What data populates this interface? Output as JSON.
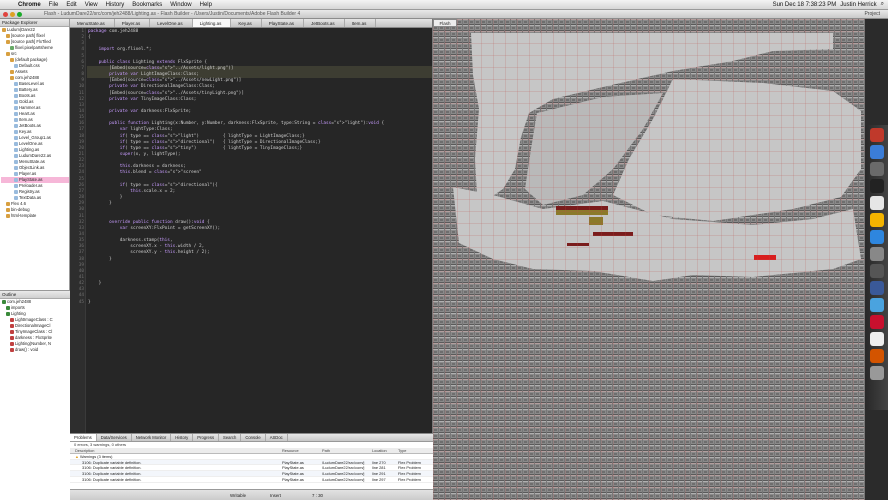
{
  "menubar": {
    "items": [
      "Chrome",
      "File",
      "Edit",
      "View",
      "History",
      "Bookmarks",
      "Window",
      "Help"
    ],
    "clock": "Sun Dec 18  7:38:23 PM",
    "user": "Justin Herrick"
  },
  "window": {
    "title": "Flash - LudumDare22/src/com/jeh2488/Lighting.as - Flash Builder - /Users/Justin/Documents/Adobe Flash Builder 4",
    "right_title": "Project"
  },
  "package_explorer": {
    "title": "Package Explorer",
    "items": [
      {
        "label": "Ludum(Dare22",
        "depth": 0,
        "color": "#d8a040"
      },
      {
        "label": "[source path] flixel",
        "depth": 1,
        "color": "#d8a040"
      },
      {
        "label": "[source path] FlxTiled",
        "depth": 1,
        "color": "#d8a040"
      },
      {
        "label": "flixel.pixelpartsheme",
        "depth": 2,
        "color": "#6a6"
      },
      {
        "label": "src",
        "depth": 1,
        "color": "#d8a040"
      },
      {
        "label": "(default package)",
        "depth": 2,
        "color": "#d8a040"
      },
      {
        "label": "Default.css",
        "depth": 3,
        "color": "#9bd"
      },
      {
        "label": "Assets",
        "depth": 2,
        "color": "#d8a040"
      },
      {
        "label": "com.jeh2488",
        "depth": 2,
        "color": "#d8a040"
      },
      {
        "label": "BaseLevel.as",
        "depth": 3,
        "color": "#9bd"
      },
      {
        "label": "Battery.as",
        "depth": 3,
        "color": "#9bd"
      },
      {
        "label": "Boots.as",
        "depth": 3,
        "color": "#9bd"
      },
      {
        "label": "Gold.as",
        "depth": 3,
        "color": "#9bd"
      },
      {
        "label": "Hammer.as",
        "depth": 3,
        "color": "#9bd"
      },
      {
        "label": "Heart.as",
        "depth": 3,
        "color": "#9bd"
      },
      {
        "label": "Item.as",
        "depth": 3,
        "color": "#9bd"
      },
      {
        "label": "JetBoots.as",
        "depth": 3,
        "color": "#9bd"
      },
      {
        "label": "Key.as",
        "depth": 3,
        "color": "#9bd"
      },
      {
        "label": "Level_Group1.as",
        "depth": 3,
        "color": "#9bd"
      },
      {
        "label": "LevelOne.as",
        "depth": 3,
        "color": "#9bd"
      },
      {
        "label": "Lighting.as",
        "depth": 3,
        "color": "#9bd"
      },
      {
        "label": "LudumDare22.as",
        "depth": 3,
        "color": "#9bd"
      },
      {
        "label": "MenuState.as",
        "depth": 3,
        "color": "#9bd"
      },
      {
        "label": "ObjectLink.as",
        "depth": 3,
        "color": "#9bd"
      },
      {
        "label": "Player.as",
        "depth": 3,
        "color": "#9bd"
      },
      {
        "label": "PlayState.as",
        "depth": 3,
        "color": "#9bd",
        "selected": true
      },
      {
        "label": "Preloader.as",
        "depth": 3,
        "color": "#9bd"
      },
      {
        "label": "Registry.as",
        "depth": 3,
        "color": "#9bd"
      },
      {
        "label": "TextData.as",
        "depth": 3,
        "color": "#9bd"
      },
      {
        "label": "Flex 4.6",
        "depth": 1,
        "color": "#d8a040"
      },
      {
        "label": "bin-debug",
        "depth": 1,
        "color": "#d8a040"
      },
      {
        "label": "html-template",
        "depth": 1,
        "color": "#d8a040"
      }
    ]
  },
  "outline": {
    "title": "Outline",
    "items": [
      {
        "label": "com.jeh2488",
        "depth": 0
      },
      {
        "label": "imports",
        "depth": 1
      },
      {
        "label": "Lighting",
        "depth": 1
      },
      {
        "label": "LightImageClass : C",
        "depth": 2
      },
      {
        "label": "DirectionalImageCl",
        "depth": 2
      },
      {
        "label": "TinyImageClass : Cl",
        "depth": 2
      },
      {
        "label": "darkness : FlxSprite",
        "depth": 2
      },
      {
        "label": "Lighting(Number, N",
        "depth": 2
      },
      {
        "label": "draw() : void",
        "depth": 2
      }
    ]
  },
  "editor_tabs": [
    "MenuState.as",
    "Player.as",
    "LevelOne.as",
    "Lighting.as",
    "Key.as",
    "PlayState.as",
    "JetBoots.as",
    "Item.as"
  ],
  "active_tab": 3,
  "code_lines": [
    "package com.jeh2488",
    "{",
    "",
    "    import org.flixel.*;",
    "",
    "    public class Lighting extends FlxSprite {",
    "        [Embed(source=\"../Assets/light.png\")]",
    "        private var LightImageClass:Class;",
    "        [Embed(source=\"../Assets/newLight.png\")]",
    "        private var DirectionalImageClass:Class;",
    "        [Embed(source=\"../Assets/tinyLight.png\")]",
    "        private var TinyImageClass:Class;",
    "",
    "        private var darkness:FlxSprite;",
    "",
    "        public function Lighting(x:Number, y:Number, darkness:FlxSprite, type:String = \"light\"):void {",
    "            var lightType:Class;",
    "            if( type == \"light\")         { lightType = LightImageClass;}",
    "            if( type == \"directional\")   { lightType = DirectionalImageClass;}",
    "            if( type == \"tiny\")          { lightType = TinyImageClass;}",
    "            super(x, y, lightType);",
    "",
    "            this.darkness = darkness;",
    "            this.blend = \"screen\"",
    "",
    "            if( type == \"directional\"){",
    "                this.scale.x = 2;",
    "            }",
    "        }",
    "",
    "",
    "        override public function draw():void {",
    "            var screenXY:FlxPoint = getScreenXY();",
    "",
    "            darkness.stamp(this,",
    "                screenXY.x - this.width / 2,",
    "                screenXY.y - this.height / 2);",
    "        }",
    "",
    "",
    "",
    "    }",
    "",
    "",
    "}"
  ],
  "problems": {
    "tabs": [
      "Problems",
      "Data/Services",
      "Network Monitor",
      "History",
      "Progress",
      "Search",
      "Console",
      "ASDoc"
    ],
    "summary": "0 errors, 3 warnings, 0 others",
    "columns": [
      "Description",
      "Resource",
      "Path",
      "Location",
      "Type"
    ],
    "group": "Warnings (3 items)",
    "rows": [
      {
        "d": "3106: Duplicate variable definition.",
        "r": "PlayState.as",
        "p": "/LudumDare22/src/com/j",
        "l": "line 270",
        "t": "Flex Problem"
      },
      {
        "d": "3106: Duplicate variable definition.",
        "r": "PlayState.as",
        "p": "/LudumDare22/src/com/j",
        "l": "line 281",
        "t": "Flex Problem"
      },
      {
        "d": "3106: Duplicate variable definition.",
        "r": "PlayState.as",
        "p": "/LudumDare22/src/com/j",
        "l": "line 291",
        "t": "Flex Problem"
      },
      {
        "d": "3106: Duplicate variable definition.",
        "r": "PlayState.as",
        "p": "/LudumDare22/src/com/j",
        "l": "line 297",
        "t": "Flex Problem"
      }
    ]
  },
  "status_bar": {
    "mode": "Writable",
    "insert": "Insert",
    "position": "7 : 30"
  },
  "game_tab": "Flash",
  "dock_icons": [
    "#c0392b",
    "#3b7dd8",
    "#6a6a6a",
    "#222",
    "#e6e6e6",
    "#f4b400",
    "#2e86de",
    "#888",
    "#555",
    "#3a5998",
    "#4aa3df",
    "#c8102e",
    "#eee",
    "#d35400",
    "#999"
  ]
}
